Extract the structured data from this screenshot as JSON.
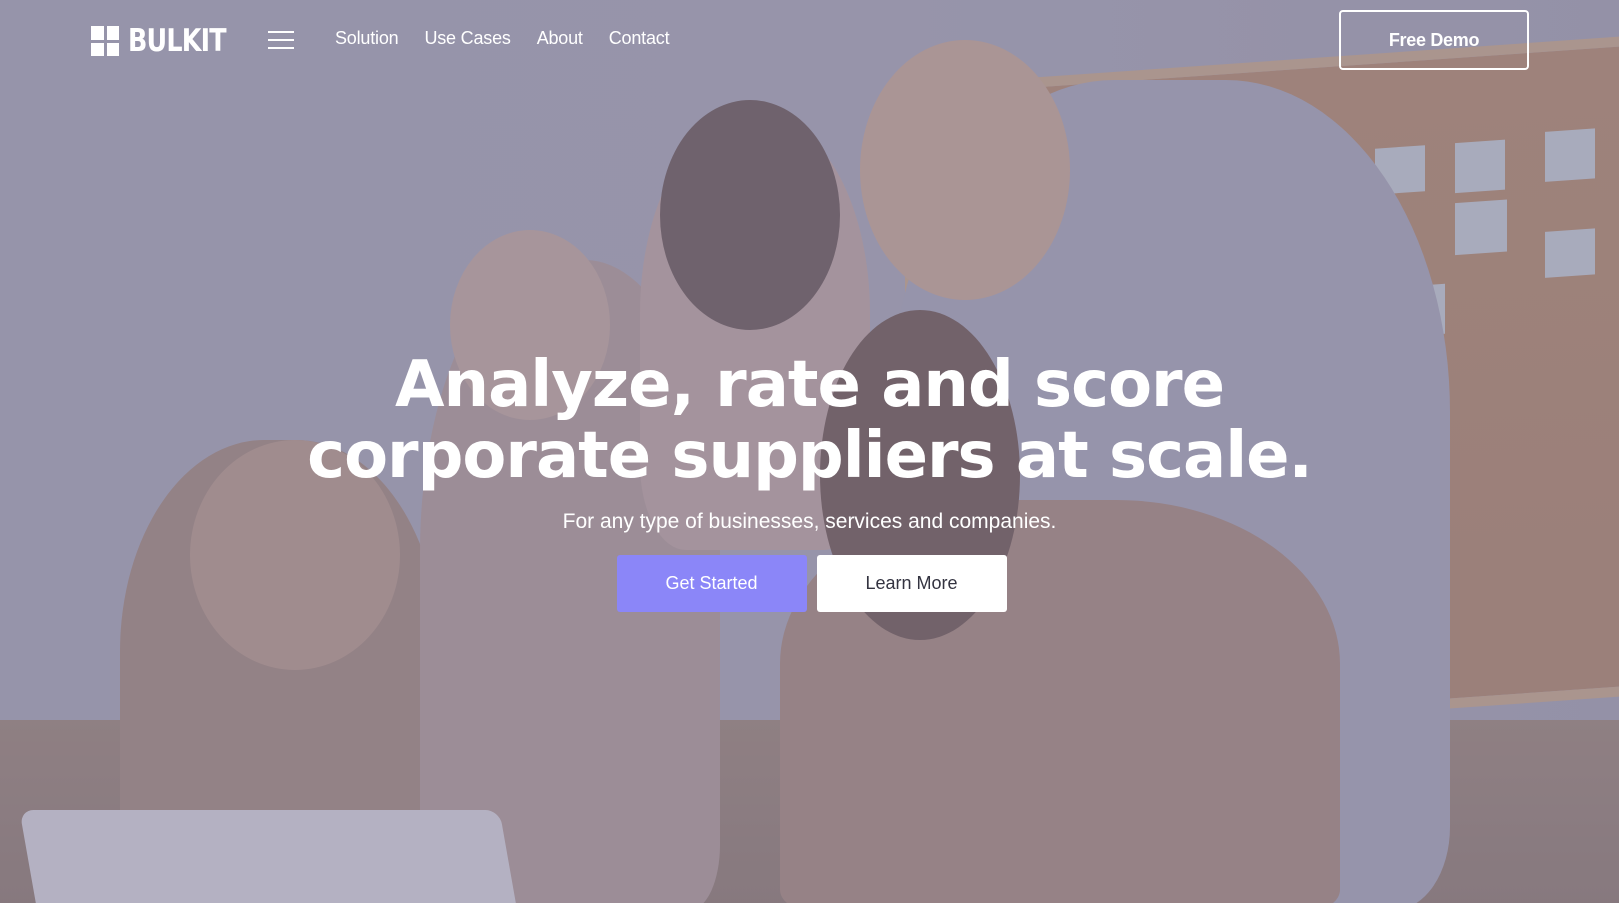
{
  "brand": {
    "name": "BULKIT"
  },
  "nav": {
    "menu_icon": "hamburger-menu-icon",
    "links": [
      {
        "label": "Solution"
      },
      {
        "label": "Use Cases"
      },
      {
        "label": "About"
      },
      {
        "label": "Contact"
      }
    ],
    "cta_label": "Free Demo"
  },
  "hero": {
    "headline_line1": "Analyze, rate and score",
    "headline_line2": "corporate suppliers at scale.",
    "subtitle": "For any type of businesses, services and companies.",
    "primary_cta": "Get Started",
    "secondary_cta": "Learn More"
  },
  "colors": {
    "accent": "#8b86f8",
    "overlay": "#787596",
    "text_light": "#ffffff"
  }
}
